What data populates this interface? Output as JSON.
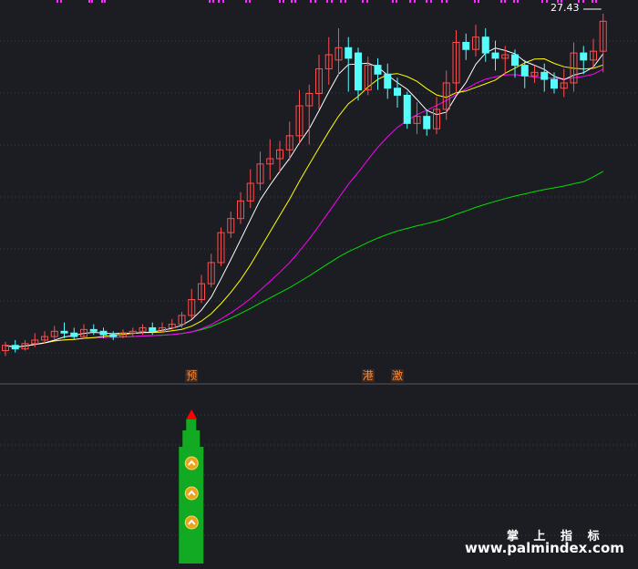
{
  "chart_data": {
    "type": "candlestick",
    "price_panel": {
      "high_label": "27.43",
      "markers": [
        {
          "text": "预",
          "candle_index": 19
        },
        {
          "text": "港",
          "candle_index": 37
        },
        {
          "text": "激",
          "candle_index": 40
        }
      ],
      "candles": [
        [
          8.3,
          8.6,
          8.0,
          8.8
        ],
        [
          8.6,
          8.4,
          8.2,
          8.9
        ],
        [
          8.4,
          8.7,
          8.3,
          8.9
        ],
        [
          8.7,
          8.9,
          8.5,
          9.3
        ],
        [
          8.9,
          9.1,
          8.7,
          9.4
        ],
        [
          9.1,
          9.4,
          8.9,
          9.7
        ],
        [
          9.4,
          9.3,
          9.0,
          9.9
        ],
        [
          9.3,
          9.1,
          8.9,
          9.6
        ],
        [
          9.1,
          9.5,
          9.0,
          9.8
        ],
        [
          9.5,
          9.4,
          9.2,
          9.8
        ],
        [
          9.4,
          9.2,
          9.0,
          9.6
        ],
        [
          9.2,
          9.1,
          8.9,
          9.4
        ],
        [
          9.1,
          9.3,
          9.0,
          9.5
        ],
        [
          9.3,
          9.4,
          9.1,
          9.6
        ],
        [
          9.4,
          9.6,
          9.2,
          9.8
        ],
        [
          9.6,
          9.4,
          9.2,
          9.9
        ],
        [
          9.4,
          9.6,
          9.3,
          9.9
        ],
        [
          9.6,
          9.8,
          9.5,
          10.1
        ],
        [
          9.8,
          10.3,
          9.6,
          10.5
        ],
        [
          10.3,
          11.2,
          10.1,
          11.8
        ],
        [
          11.2,
          12.1,
          11.0,
          12.6
        ],
        [
          12.1,
          13.3,
          11.9,
          13.8
        ],
        [
          13.3,
          15.0,
          13.1,
          15.3
        ],
        [
          15.0,
          15.8,
          14.7,
          16.2
        ],
        [
          15.8,
          16.8,
          15.5,
          17.3
        ],
        [
          16.8,
          17.8,
          16.4,
          18.6
        ],
        [
          17.8,
          18.9,
          17.4,
          19.6
        ],
        [
          18.9,
          19.2,
          18.0,
          20.3
        ],
        [
          19.2,
          19.7,
          18.4,
          20.2
        ],
        [
          19.7,
          20.5,
          19.1,
          21.3
        ],
        [
          20.5,
          22.2,
          20.1,
          23.1
        ],
        [
          22.2,
          22.9,
          20.0,
          23.4
        ],
        [
          22.9,
          24.3,
          22.0,
          25.1
        ],
        [
          24.3,
          25.1,
          23.4,
          26.1
        ],
        [
          24.8,
          25.5,
          23.9,
          26.6
        ],
        [
          25.5,
          24.9,
          23.0,
          26.1
        ],
        [
          25.2,
          23.1,
          22.5,
          25.5
        ],
        [
          23.1,
          24.5,
          22.8,
          25.0
        ],
        [
          24.5,
          24.0,
          23.1,
          24.9
        ],
        [
          24.0,
          23.2,
          22.6,
          24.6
        ],
        [
          23.2,
          22.8,
          22.1,
          23.8
        ],
        [
          22.8,
          21.2,
          20.9,
          23.0
        ],
        [
          21.2,
          21.6,
          20.6,
          22.4
        ],
        [
          21.6,
          20.9,
          20.5,
          21.9
        ],
        [
          20.9,
          22.0,
          20.6,
          22.7
        ],
        [
          22.0,
          23.5,
          21.4,
          24.2
        ],
        [
          23.5,
          25.8,
          22.9,
          26.5
        ],
        [
          25.8,
          25.4,
          24.8,
          26.3
        ],
        [
          25.4,
          26.1,
          25.0,
          26.8
        ],
        [
          26.1,
          25.2,
          24.7,
          26.6
        ],
        [
          25.2,
          24.9,
          24.2,
          25.9
        ],
        [
          24.9,
          25.1,
          24.0,
          25.6
        ],
        [
          25.1,
          24.5,
          23.8,
          25.4
        ],
        [
          24.5,
          23.9,
          23.2,
          24.8
        ],
        [
          23.9,
          24.1,
          23.5,
          24.5
        ],
        [
          24.1,
          23.7,
          23.0,
          24.6
        ],
        [
          23.7,
          23.2,
          22.9,
          24.1
        ],
        [
          23.2,
          23.5,
          22.7,
          24.3
        ],
        [
          23.5,
          25.2,
          23.0,
          25.8
        ],
        [
          25.2,
          24.8,
          24.0,
          25.6
        ],
        [
          24.8,
          25.3,
          24.3,
          26.0
        ],
        [
          25.3,
          27.0,
          24.1,
          27.43
        ]
      ]
    },
    "indicator_panel": {
      "signal_start_index": 19,
      "signal_glyph": "︽"
    },
    "colors": {
      "up": "#ff4d4d",
      "down": "#54fcfc",
      "ma5": "#ffffff",
      "ma10": "#ffff00",
      "ma20": "#ff00ff",
      "ma60": "#00e000",
      "signal": "#11aa22",
      "signal_top": "#ff0000"
    }
  },
  "watermark": {
    "cn": "掌 上 指 标",
    "url": "www.palmindex.com"
  }
}
